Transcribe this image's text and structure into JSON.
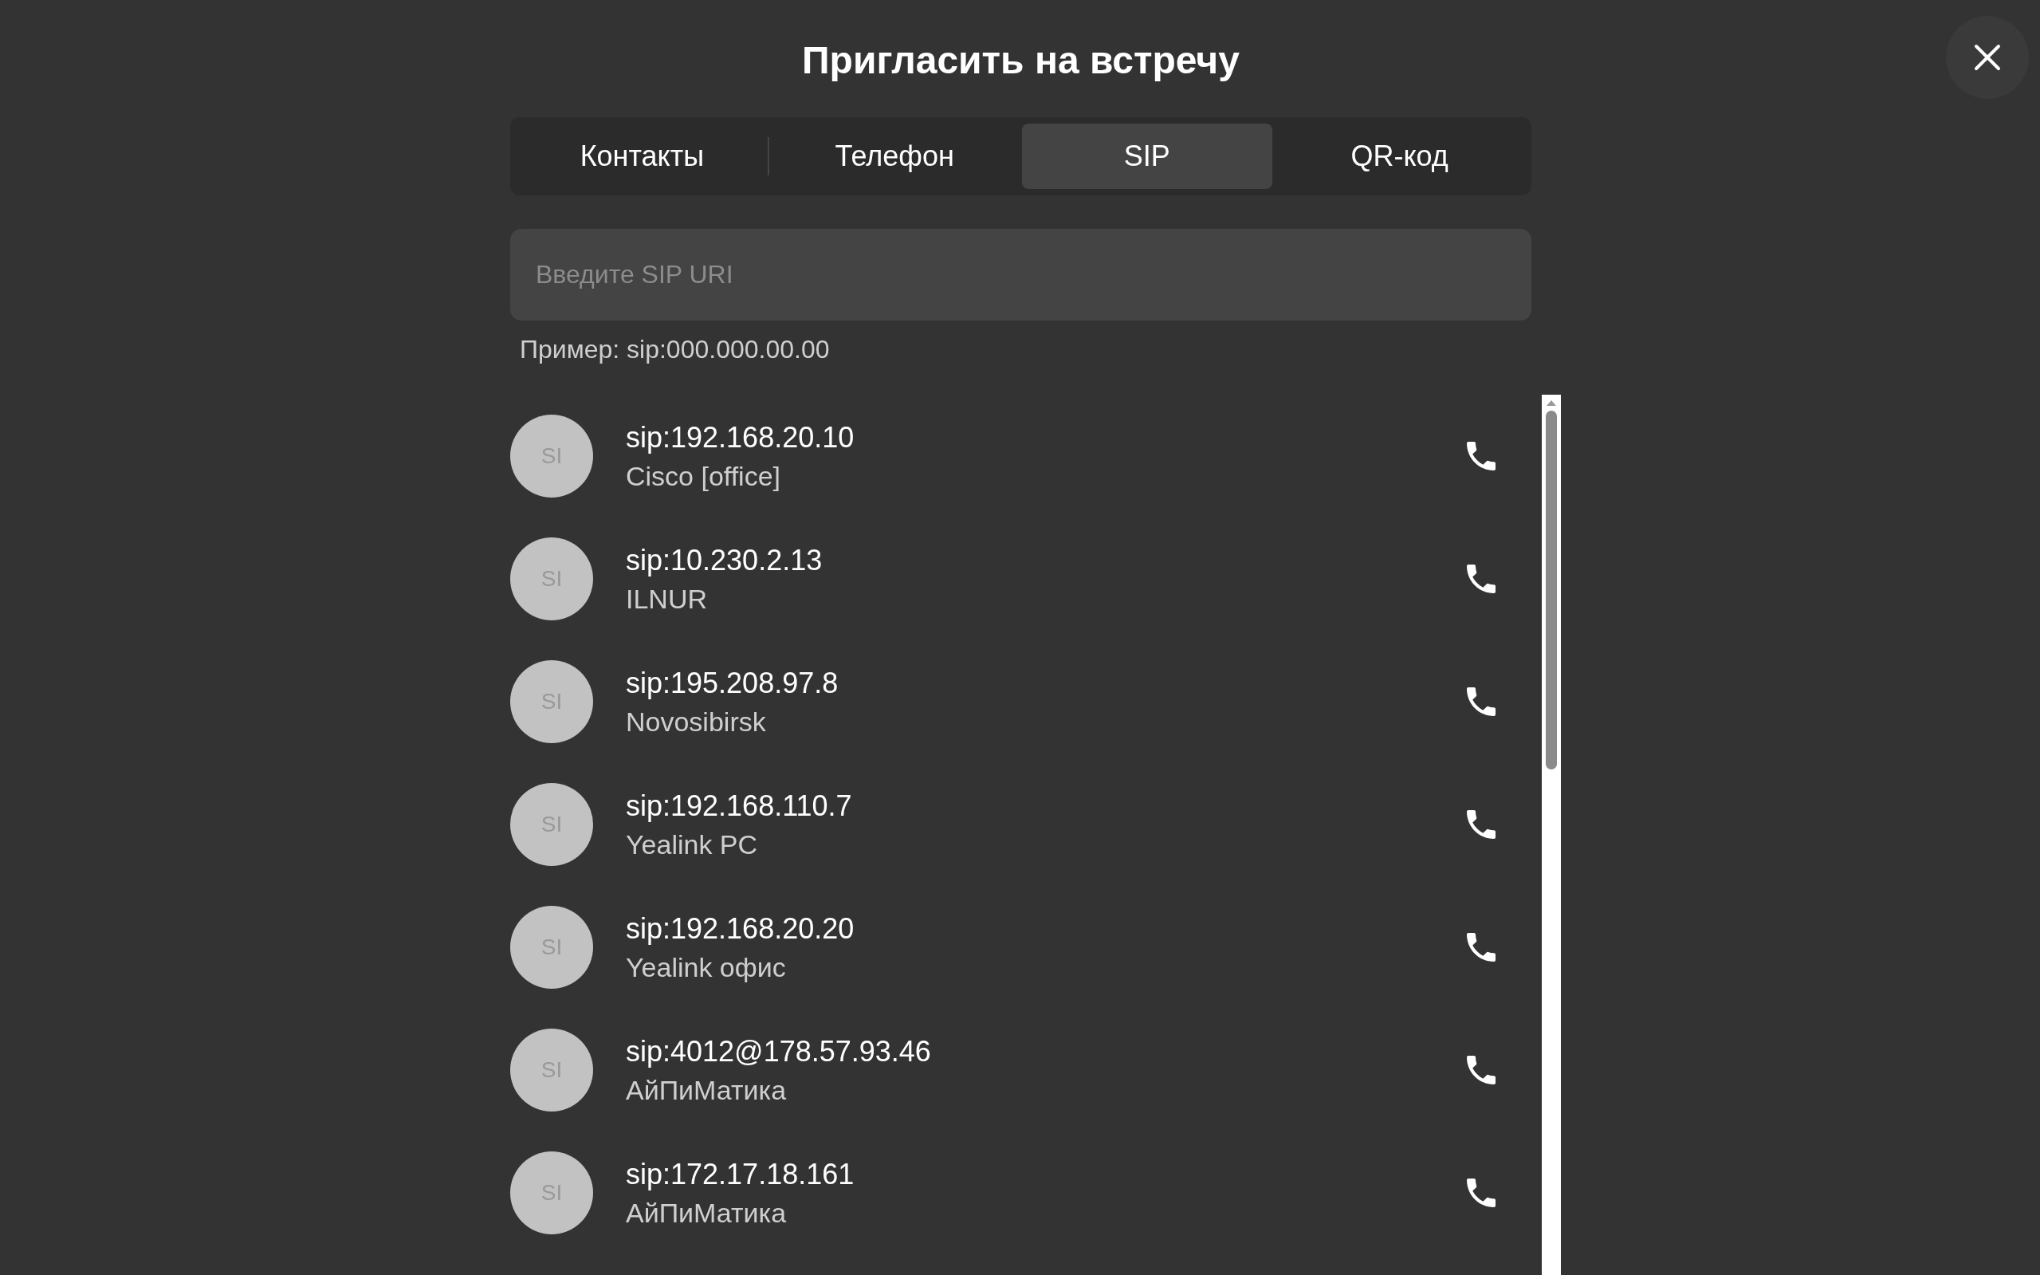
{
  "dialog": {
    "title": "Пригласить на встречу"
  },
  "tabs": [
    {
      "label": "Контакты",
      "selected": false
    },
    {
      "label": "Телефон",
      "selected": false
    },
    {
      "label": "SIP",
      "selected": true
    },
    {
      "label": "QR-код",
      "selected": false
    }
  ],
  "sip_field": {
    "placeholder": "Введите SIP URI"
  },
  "hint": "Пример: sip:000.000.00.00",
  "contacts": [
    {
      "initials": "SI",
      "address": "sip:192.168.20.10",
      "name": "Cisco [office]"
    },
    {
      "initials": "SI",
      "address": "sip:10.230.2.13",
      "name": "ILNUR"
    },
    {
      "initials": "SI",
      "address": "sip:195.208.97.8",
      "name": "Novosibirsk"
    },
    {
      "initials": "SI",
      "address": "sip:192.168.110.7",
      "name": "Yealink PC"
    },
    {
      "initials": "SI",
      "address": "sip:192.168.20.20",
      "name": "Yealink офис"
    },
    {
      "initials": "SI",
      "address": "sip:4012@178.57.93.46",
      "name": "АйПиМатика"
    },
    {
      "initials": "SI",
      "address": "sip:172.17.18.161",
      "name": "АйПиМатика"
    }
  ]
}
